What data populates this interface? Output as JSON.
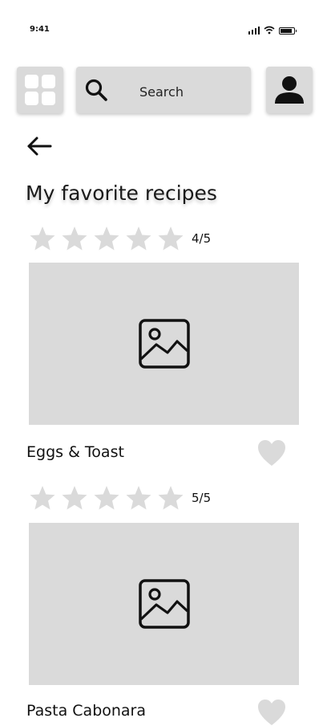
{
  "status_bar": {
    "time": "9:41",
    "icons": [
      "signal-icon",
      "wifi-icon",
      "battery-icon"
    ]
  },
  "toolbar": {
    "menu_icon": "grid-icon",
    "search_placeholder": "Search",
    "profile_icon": "user-icon"
  },
  "page": {
    "back_icon": "arrow-left-icon",
    "title": "My favorite recipes"
  },
  "recipes": [
    {
      "rating_text": "4/5",
      "name": "Eggs & Toast",
      "image_icon": "image-placeholder-icon",
      "favorite_icon": "heart-icon"
    },
    {
      "rating_text": "5/5",
      "name": "Pasta Cabonara",
      "image_icon": "image-placeholder-icon",
      "favorite_icon": "heart-icon"
    }
  ],
  "colors": {
    "placeholder_gray": "#dadada",
    "star_gray": "#dadada",
    "text": "#111111"
  }
}
